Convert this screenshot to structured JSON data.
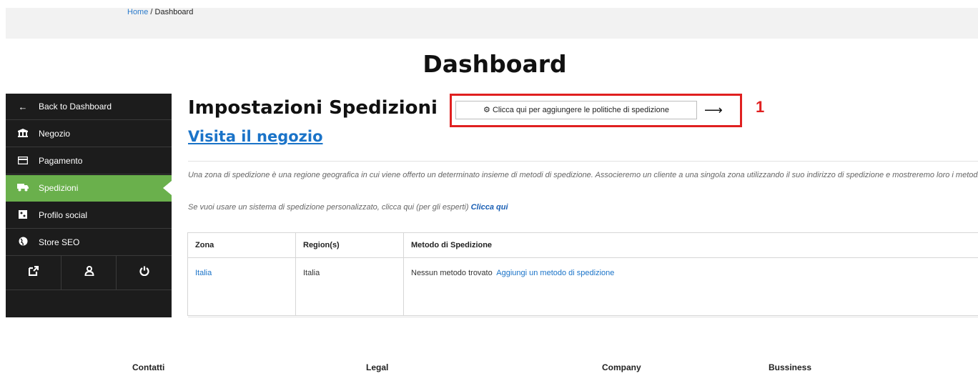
{
  "breadcrumb": {
    "home": "Home",
    "sep": " / ",
    "current": "Dashboard"
  },
  "page_title": "Dashboard",
  "sidebar": {
    "items": [
      {
        "label": "Back to Dashboard",
        "icon": "arrow-left-icon",
        "glyph": "←"
      },
      {
        "label": "Negozio",
        "icon": "bank-icon",
        "glyph": "🏛"
      },
      {
        "label": "Pagamento",
        "icon": "credit-card-icon",
        "glyph": "▭"
      },
      {
        "label": "Spedizioni",
        "icon": "truck-icon",
        "glyph": "⛟",
        "active": true
      },
      {
        "label": "Profilo social",
        "icon": "social-icon",
        "glyph": "■"
      },
      {
        "label": "Store SEO",
        "icon": "globe-icon",
        "glyph": "◉"
      }
    ],
    "icon_row": [
      {
        "name": "external-link-icon",
        "glyph": "↗"
      },
      {
        "name": "user-icon",
        "glyph": "♙"
      },
      {
        "name": "power-icon",
        "glyph": "⏻"
      }
    ]
  },
  "main": {
    "title": "Impostazioni Spedizioni",
    "add_policy_button": "Clicca qui per aggiungere le politiche di spedizione",
    "add_policy_icon": "gear-icon",
    "arrow": "⟶",
    "annotation_number": "1",
    "annotation_color": "#e02020",
    "visit_link": "Visita il negozio",
    "description": "Una zona di spedizione è una regione geografica in cui viene offerto un determinato insieme di metodi di spedizione. Associeremo un cliente a una singola zona utilizzando il suo indirizzo di spedizione e mostreremo loro i metodi di spedizione all'interno di quella zona.",
    "custom_text": "Se vuoi usare un sistema di spedizione personalizzato, clicca qui (per gli esperti)",
    "custom_link": "Clicca qui"
  },
  "table": {
    "headers": [
      "Zona",
      "Region(s)",
      "Metodo di Spedizione"
    ],
    "rows": [
      {
        "zona": "Italia",
        "region": "Italia",
        "metodo_text": "Nessun metodo trovato",
        "metodo_link": "Aggiungi un metodo di spedizione"
      }
    ]
  },
  "footer": {
    "cols": [
      "Contatti",
      "Legal",
      "Company",
      "Bussiness"
    ]
  },
  "colors": {
    "sidebar_bg": "#1c1c1c",
    "active": "#6ab04c",
    "link": "#1a73c8"
  }
}
